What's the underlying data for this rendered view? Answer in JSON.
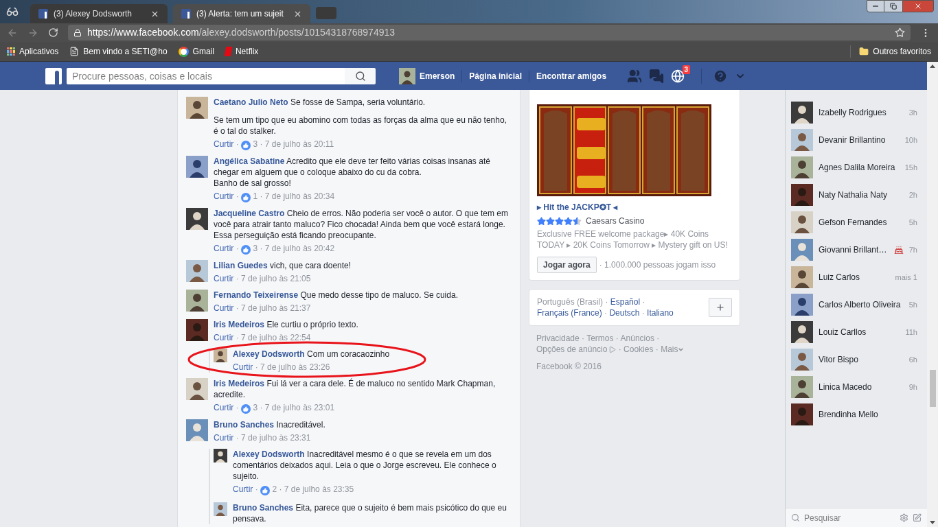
{
  "browser": {
    "tabs": [
      {
        "title": "(3) Alexey Dodsworth",
        "selected": false
      },
      {
        "title": "(3) Alerta: tem um sujeit",
        "selected": true
      }
    ],
    "url_host": "https://www.facebook.com",
    "url_path": "/alexey.dodsworth/posts/10154318768974913",
    "bookmarks": [
      {
        "label": "Aplicativos",
        "kind": "apps"
      },
      {
        "label": "Bem vindo a SETI@ho",
        "kind": "page"
      },
      {
        "label": "Gmail",
        "kind": "google"
      },
      {
        "label": "Netflix",
        "kind": "netflix"
      }
    ],
    "other_bookmarks": "Outros favoritos"
  },
  "header": {
    "search_placeholder": "Procure pessoas, coisas e locais",
    "user": "Emerson",
    "nav": [
      "Página inicial",
      "Encontrar amigos"
    ],
    "notifications_badge": "3"
  },
  "separator": "·",
  "comments": [
    {
      "author": "Caetano Julio Neto",
      "paragraphs": [
        "Se fosse de Sampa, seria voluntário.",
        "Se tem um tipo que eu abomino com todas as forças da alma que eu não tenho, é o tal do stalker."
      ],
      "like_label": "Curtir",
      "likes": "3",
      "time": "7 de julho às 20:11"
    },
    {
      "author": "Angélica Sabatine",
      "paragraphs": [
        "Acredito que ele deve ter feito várias coisas insanas até chegar em alguem que o coloque abaixo do cu da cobra.\nBanho de sal grosso!"
      ],
      "like_label": "Curtir",
      "likes": "1",
      "time": "7 de julho às 20:34"
    },
    {
      "author": "Jacqueline Castro",
      "paragraphs": [
        "Cheio de erros. Não poderia ser você o autor. O que tem em você para atrair tanto maluco? Fico chocada! Ainda bem que você estará longe. Essa perseguição está ficando preocupante."
      ],
      "like_label": "Curtir",
      "likes": "3",
      "time": "7 de julho às 20:42"
    },
    {
      "author": "Lilian Guedes",
      "paragraphs": [
        "vich, que cara doente!"
      ],
      "like_label": "Curtir",
      "time": "7 de julho às 21:05"
    },
    {
      "author": "Fernando Teixeirense",
      "paragraphs": [
        "Que medo desse tipo de maluco. Se cuida."
      ],
      "like_label": "Curtir",
      "time": "7 de julho às 21:37"
    },
    {
      "author": "Iris Medeiros",
      "paragraphs": [
        "Ele curtiu o próprio texto."
      ],
      "like_label": "Curtir",
      "time": "7 de julho às 22:54",
      "replies": [
        {
          "author": "Alexey Dodsworth",
          "paragraphs": [
            "Com um coracaozinho"
          ],
          "like_label": "Curtir",
          "time": "7 de julho às 23:26",
          "highlighted": true
        }
      ]
    },
    {
      "author": "Iris Medeiros",
      "paragraphs": [
        "Fui lá ver a cara dele. É de maluco no sentido Mark Chapman, acredite."
      ],
      "like_label": "Curtir",
      "likes": "3",
      "time": "7 de julho às 23:01"
    },
    {
      "author": "Bruno Sanches",
      "paragraphs": [
        "Inacreditável."
      ],
      "like_label": "Curtir",
      "time": "7 de julho às 23:31",
      "replies": [
        {
          "author": "Alexey Dodsworth",
          "paragraphs": [
            "Inacreditável mesmo é o que se revela em um dos comentários deixados aqui. Leia o que o Jorge escreveu. Ele conhece o sujeito."
          ],
          "like_label": "Curtir",
          "likes": "2",
          "time": "7 de julho às 23:35",
          "highlighted": false
        },
        {
          "author": "Bruno Sanches",
          "paragraphs": [
            "Eita, parece que o sujeito é bem mais psicótico do que eu pensava."
          ],
          "highlighted": false
        }
      ]
    }
  ],
  "ad": {
    "title": "▸ Hit the JACKP✪T ◂",
    "stars": 4.5,
    "advertiser": "Caesars Casino",
    "description": "Exclusive FREE welcome package▸ 40K Coins TODAY ▸ 20K Coins Tomorrow ▸ Mystery gift on US!",
    "button": "Jogar agora",
    "social": "· 1.000.000 pessoas jogam isso"
  },
  "languages": [
    {
      "label": "Português (Brasil)",
      "current": true
    },
    {
      "label": "Español",
      "current": false
    },
    {
      "label": "Français (France)",
      "current": false
    },
    {
      "label": "Deutsch",
      "current": false
    },
    {
      "label": "Italiano",
      "current": false
    }
  ],
  "footer": {
    "links": [
      "Privacidade",
      "Termos",
      "Anúncios",
      "Opções de anúncio",
      "Cookies",
      "Mais"
    ],
    "copyright": "Facebook © 2016"
  },
  "chat": {
    "contacts": [
      {
        "name": "Izabelly Rodrigues",
        "time": "3h",
        "birthday": false
      },
      {
        "name": "Devanir Brillantino",
        "time": "10h",
        "birthday": false
      },
      {
        "name": "Agnes Dalila Moreira",
        "time": "15h",
        "birthday": false
      },
      {
        "name": "Naty Nathalia Naty",
        "time": "2h",
        "birthday": false
      },
      {
        "name": "Gefson Fernandes",
        "time": "5h",
        "birthday": false
      },
      {
        "name": "Giovanni Brillant…",
        "time": "7h",
        "birthday": true
      },
      {
        "name": "Luiz Carlos",
        "time": "mais 1",
        "birthday": false
      },
      {
        "name": "Carlos Alberto Oliveira",
        "time": "5h",
        "birthday": false
      },
      {
        "name": "Louiz Carllos",
        "time": "11h",
        "birthday": false
      },
      {
        "name": "Vitor Bispo",
        "time": "6h",
        "birthday": false
      },
      {
        "name": "Linica Macedo",
        "time": "9h",
        "birthday": false
      },
      {
        "name": "Brendinha Mello",
        "birthday": false
      }
    ],
    "search_placeholder": "Pesquisar"
  }
}
